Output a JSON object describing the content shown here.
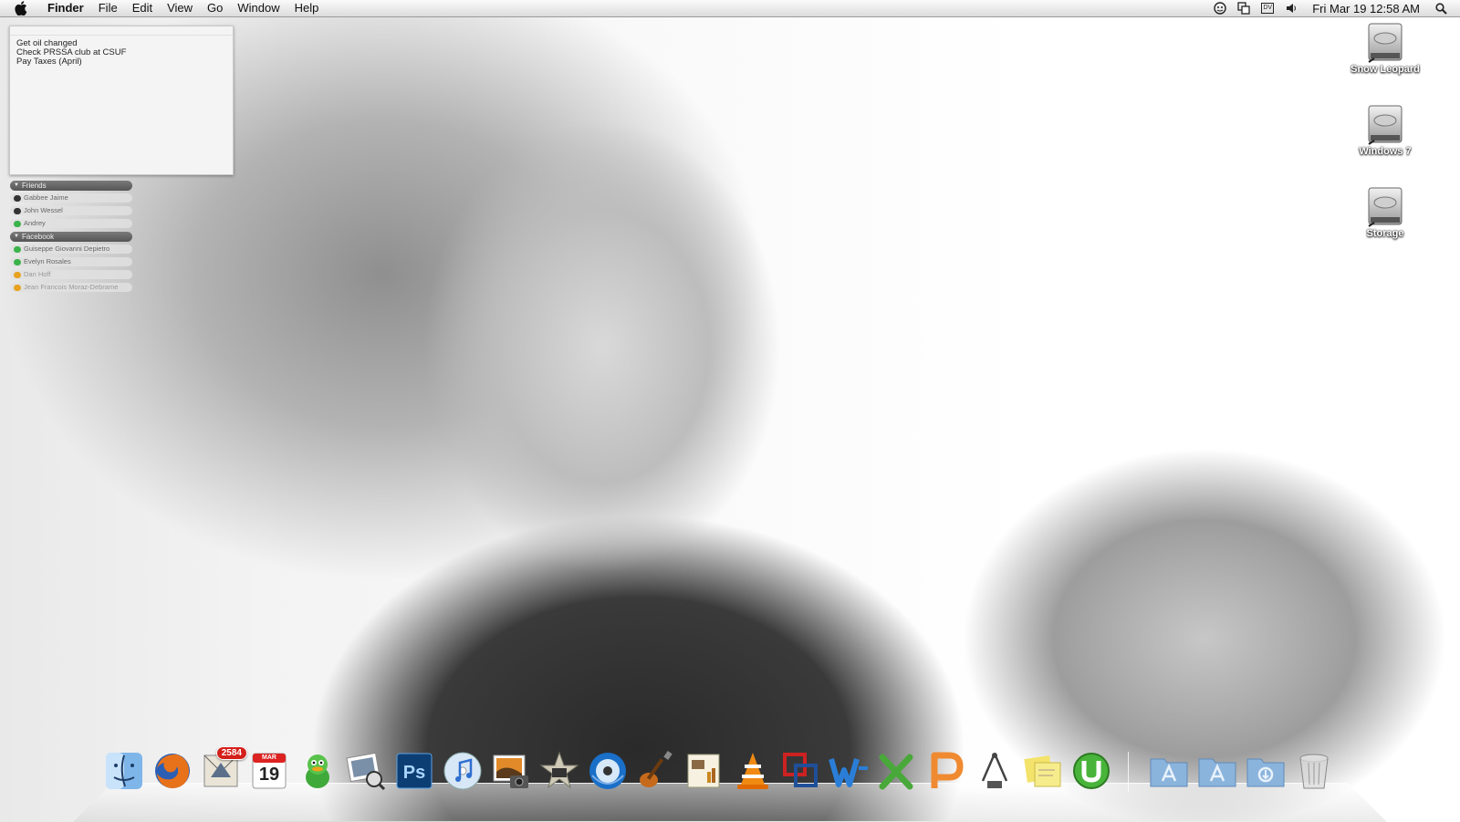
{
  "menubar": {
    "app_name": "Finder",
    "menus": [
      "File",
      "Edit",
      "View",
      "Go",
      "Window",
      "Help"
    ],
    "status_icons": [
      "adium-duck-icon",
      "sync-icon",
      "dv-icon",
      "volume-icon"
    ],
    "dv_label": "DV",
    "clock": "Fri Mar 19  12:58 AM"
  },
  "sticky_note": {
    "lines": [
      "Get oil changed",
      "Check PRSSA club at CSUF",
      "Pay Taxes (April)"
    ]
  },
  "buddy_list": {
    "groups": [
      {
        "name": "Friends",
        "buddies": [
          {
            "name": "Gabbee Jaime",
            "status": "away"
          },
          {
            "name": "John Wessel",
            "status": "away"
          },
          {
            "name": "Andrey",
            "status": "online"
          }
        ]
      },
      {
        "name": "Facebook",
        "buddies": [
          {
            "name": "Guiseppe Giovanni Depietro",
            "status": "online"
          },
          {
            "name": "Evelyn Rosales",
            "status": "online"
          },
          {
            "name": "Dan Hoff",
            "status": "idle"
          },
          {
            "name": "Jean Francois Moraz-Debrame",
            "status": "idle"
          }
        ]
      }
    ]
  },
  "desktop_drives": [
    {
      "label": "Snow Leopard"
    },
    {
      "label": "Windows 7"
    },
    {
      "label": "Storage"
    }
  ],
  "dock": {
    "apps": [
      {
        "name": "finder-icon"
      },
      {
        "name": "firefox-icon"
      },
      {
        "name": "mail-icon",
        "badge": "2584"
      },
      {
        "name": "ical-icon",
        "month": "MAR",
        "day": "19"
      },
      {
        "name": "adium-icon"
      },
      {
        "name": "iphoto-viewer-icon"
      },
      {
        "name": "photoshop-icon",
        "label": "Ps"
      },
      {
        "name": "itunes-icon"
      },
      {
        "name": "iphoto-icon"
      },
      {
        "name": "imovie-icon"
      },
      {
        "name": "dvd-player-icon"
      },
      {
        "name": "garageband-icon"
      },
      {
        "name": "preview-icon"
      },
      {
        "name": "vlc-icon"
      },
      {
        "name": "parallels-icon"
      },
      {
        "name": "word-icon"
      },
      {
        "name": "excel-icon"
      },
      {
        "name": "powerpoint-icon"
      },
      {
        "name": "utilities-icon"
      },
      {
        "name": "stickies-icon"
      },
      {
        "name": "utorrent-icon"
      }
    ],
    "stacks": [
      {
        "name": "applications-folder-icon"
      },
      {
        "name": "apps-folder-icon"
      },
      {
        "name": "downloads-folder-icon"
      },
      {
        "name": "trash-icon"
      }
    ]
  },
  "colors": {
    "badge": "#d4201a",
    "online": "#3bb34a",
    "idle": "#e7a21f"
  }
}
